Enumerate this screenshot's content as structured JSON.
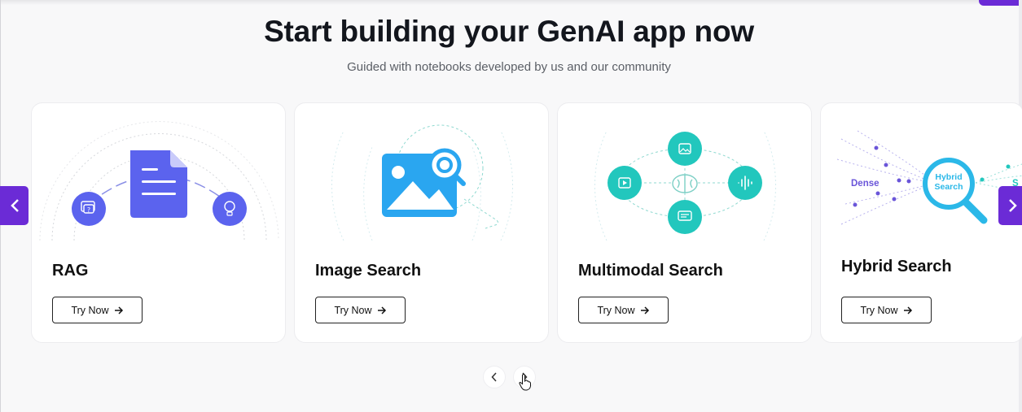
{
  "header": {
    "title": "Start building your GenAI app now",
    "subtitle": "Guided with notebooks developed by us and our community"
  },
  "cards": [
    {
      "title": "RAG",
      "button": "Try Now",
      "illustration": "document-with-chat-and-lightbulb"
    },
    {
      "title": "Image Search",
      "button": "Try Now",
      "illustration": "image-with-magnifier"
    },
    {
      "title": "Multimodal Search",
      "button": "Try Now",
      "illustration": "brain-with-modalities"
    },
    {
      "title": "Hybrid Search",
      "button": "Try Now",
      "illustration": "hybrid-search-magnifier",
      "art_labels": {
        "left": "Dense",
        "center": "Hybrid Search",
        "right_partial": "S"
      }
    }
  ],
  "carousel": {
    "prev_icon": "chevron-left-icon",
    "next_icon": "chevron-right-icon"
  },
  "pager": {
    "prev_icon": "chevron-left-icon",
    "next_icon": "chevron-right-icon"
  },
  "colors": {
    "accent": "#6b2bd6",
    "rag_blue": "#5b63ee",
    "image_blue": "#2aa6f0",
    "teal": "#22c7bd",
    "hybrid_cyan": "#2bb8e8",
    "dense_purple": "#6a55d9"
  }
}
